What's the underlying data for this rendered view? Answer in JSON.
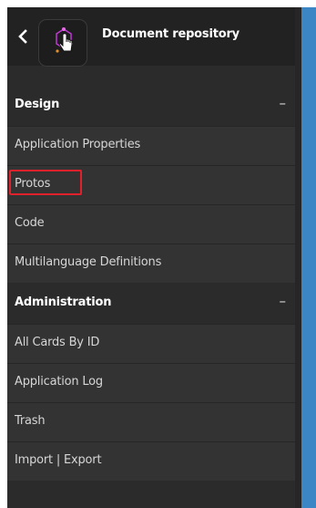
{
  "header": {
    "title": "Document repository",
    "back_icon": "chevron-left-icon",
    "logo_icon": "app-logo-icon"
  },
  "sections": [
    {
      "title": "Design",
      "collapse_symbol": "–",
      "items": [
        {
          "label": "Application Properties"
        },
        {
          "label": "Protos",
          "highlighted": true
        },
        {
          "label": "Code"
        },
        {
          "label": "Multilanguage Definitions"
        }
      ]
    },
    {
      "title": "Administration",
      "collapse_symbol": "–",
      "items": [
        {
          "label": "All Cards By ID"
        },
        {
          "label": "Application Log"
        },
        {
          "label": "Trash"
        },
        {
          "label": "Import | Export"
        }
      ]
    }
  ],
  "colors": {
    "panel": "#2b2b2b",
    "header": "#222222",
    "item": "#333333",
    "highlight": "#e0202a",
    "accent_blue": "#3c86c6"
  }
}
